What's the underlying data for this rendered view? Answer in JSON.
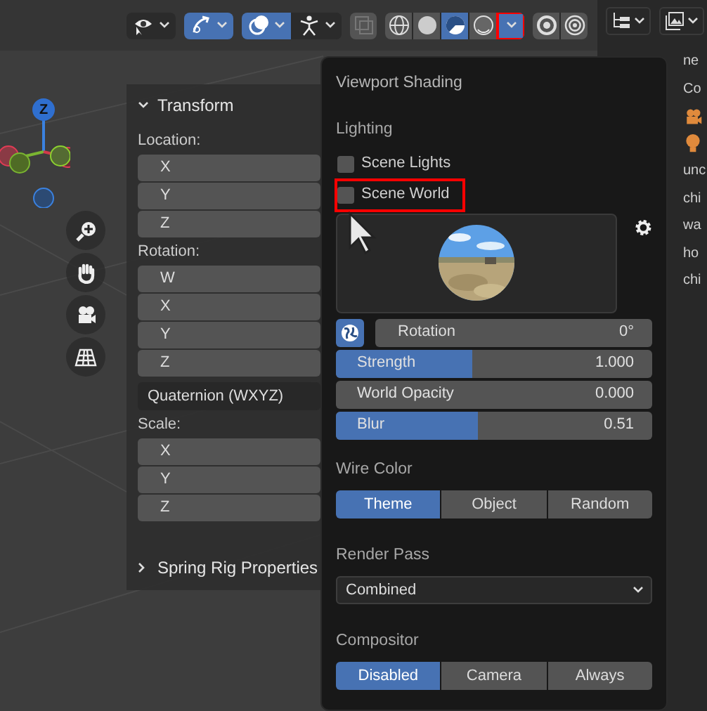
{
  "header": {
    "toolbar": [
      {
        "kind": "visibility",
        "selected": false,
        "caret": true
      },
      {
        "kind": "gizmos",
        "selected": true,
        "caret": true
      },
      {
        "kind": "overlays",
        "selected": true,
        "caret": true
      },
      {
        "kind": "bones",
        "selected": false,
        "caret": true
      },
      {
        "kind": "xray",
        "selected": false,
        "caret": false
      },
      {
        "kind": "wireframe",
        "selected": false,
        "caret": false
      },
      {
        "kind": "solid",
        "selected": false,
        "caret": false
      },
      {
        "kind": "material",
        "selected": true,
        "caret": false
      },
      {
        "kind": "rendered",
        "selected": false,
        "caret": false
      },
      {
        "kind": "shading-menu",
        "selected": true,
        "caret": false,
        "highlighted": true
      },
      {
        "kind": "ring",
        "selected": false,
        "caret": false
      },
      {
        "kind": "rings",
        "selected": false,
        "caret": false
      }
    ]
  },
  "gizmo": {
    "axis_label": "Z"
  },
  "sidebar": {
    "panels": [
      {
        "title": "Transform",
        "expanded": true,
        "groups": [
          {
            "label": "Location:",
            "fields": [
              "X",
              "Y",
              "Z"
            ]
          },
          {
            "label": "Rotation:",
            "fields": [
              "W",
              "X",
              "Y",
              "Z"
            ],
            "mode": "Quaternion (WXYZ)"
          },
          {
            "label": "Scale:",
            "fields": [
              "X",
              "Y",
              "Z"
            ]
          }
        ]
      },
      {
        "title": "Spring Rig Properties",
        "expanded": false
      }
    ]
  },
  "popover": {
    "title": "Viewport Shading",
    "lighting": {
      "label": "Lighting",
      "options": [
        {
          "label": "Scene Lights",
          "checked": false,
          "highlighted": false
        },
        {
          "label": "Scene World",
          "checked": false,
          "highlighted": true
        }
      ]
    },
    "rotation": {
      "label": "Rotation",
      "value": "0°"
    },
    "sliders": [
      {
        "label": "Strength",
        "value": "1.000",
        "level": 0.43
      },
      {
        "label": "World Opacity",
        "value": "0.000",
        "level": 0
      },
      {
        "label": "Blur",
        "value": "0.51",
        "level": 0.45
      }
    ],
    "wire_color": {
      "label": "Wire Color",
      "options": [
        {
          "label": "Theme",
          "selected": true
        },
        {
          "label": "Object",
          "selected": false
        },
        {
          "label": "Random",
          "selected": false
        }
      ]
    },
    "render_pass": {
      "label": "Render Pass",
      "value": "Combined"
    },
    "compositor": {
      "label": "Compositor",
      "options": [
        {
          "label": "Disabled",
          "selected": true
        },
        {
          "label": "Camera",
          "selected": false
        },
        {
          "label": "Always",
          "selected": false
        }
      ]
    }
  },
  "outliner": {
    "items": [
      {
        "kind": "text",
        "text": "ne"
      },
      {
        "kind": "text",
        "text": "Co"
      },
      {
        "kind": "camera"
      },
      {
        "kind": "light"
      },
      {
        "kind": "text",
        "text": "unc"
      },
      {
        "kind": "text",
        "text": "chi"
      },
      {
        "kind": "text",
        "text": "wa"
      },
      {
        "kind": "text",
        "text": "ho"
      },
      {
        "kind": "text",
        "text": "chi"
      }
    ]
  }
}
